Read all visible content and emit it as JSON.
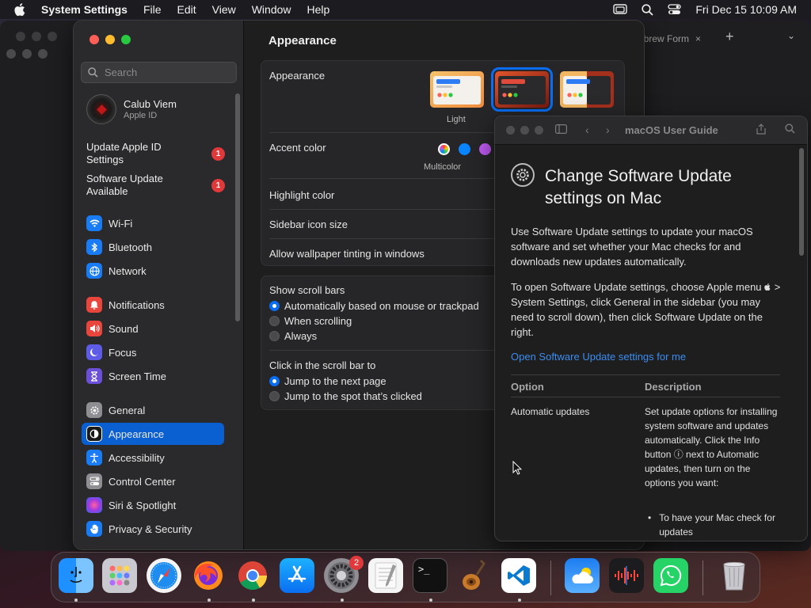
{
  "menubar": {
    "app_name": "System Settings",
    "items": [
      "File",
      "Edit",
      "View",
      "Window",
      "Help"
    ],
    "datetime": "Fri Dec 15  10:09 AM"
  },
  "browser": {
    "tab_title": "hbrew Form",
    "tab_close": "×",
    "new_tab": "+",
    "chevron": "⌄"
  },
  "sidebar": {
    "search_placeholder": "Search",
    "account_name": "Calub Viem",
    "account_sub": "Apple ID",
    "alerts": [
      {
        "label": "Update Apple ID Settings",
        "count": "1"
      },
      {
        "label": "Software Update Available",
        "count": "1"
      }
    ],
    "items": [
      {
        "label": "Wi-Fi",
        "icon": "wifi-icon",
        "color": "#1a7cf5"
      },
      {
        "label": "Bluetooth",
        "icon": "bluetooth-icon",
        "color": "#1a7cf5"
      },
      {
        "label": "Network",
        "icon": "globe-icon",
        "color": "#1a7cf5"
      },
      {
        "label": "Notifications",
        "icon": "bell-icon",
        "color": "#e8453c"
      },
      {
        "label": "Sound",
        "icon": "speaker-icon",
        "color": "#e8453c"
      },
      {
        "label": "Focus",
        "icon": "moon-icon",
        "color": "#5e5ce6"
      },
      {
        "label": "Screen Time",
        "icon": "hourglass-icon",
        "color": "#6b4fd8"
      },
      {
        "label": "General",
        "icon": "gear-icon",
        "color": "#8e8e93"
      },
      {
        "label": "Appearance",
        "icon": "appearance-icon",
        "color": "#1a1a1a"
      },
      {
        "label": "Accessibility",
        "icon": "accessibility-icon",
        "color": "#1a7cf5"
      },
      {
        "label": "Control Center",
        "icon": "control-center-icon",
        "color": "#8e8e93"
      },
      {
        "label": "Siri & Spotlight",
        "icon": "siri-icon",
        "color": "#c03ad1"
      },
      {
        "label": "Privacy & Security",
        "icon": "hand-icon",
        "color": "#1a7cf5"
      }
    ],
    "selected": "Appearance"
  },
  "main": {
    "title": "Appearance",
    "appearance_label": "Appearance",
    "appearance_options": [
      "Light"
    ],
    "accent_label": "Accent color",
    "accent_selected": "Multicolor",
    "accent_colors": [
      "#ff2d55",
      "#0a84ff",
      "#bf5af2"
    ],
    "highlight_label": "Highlight color",
    "sidebar_icon_label": "Sidebar icon size",
    "wallpaper_tint_label": "Allow wallpaper tinting in windows",
    "scroll_bars_label": "Show scroll bars",
    "scroll_bar_options": [
      "Automatically based on mouse or trackpad",
      "When scrolling",
      "Always"
    ],
    "scroll_bar_selected": 0,
    "click_label": "Click in the scroll bar to",
    "click_options": [
      "Jump to the next page",
      "Jump to the spot that’s clicked"
    ],
    "click_selected": 0
  },
  "help": {
    "window_title": "macOS User Guide",
    "heading": "Change Software Update settings on Mac",
    "para1": "Use Software Update settings to update your macOS software and set whether your Mac checks for and downloads new updates automatically.",
    "para2": " > System Settings, click General  in the sidebar (you may need to scroll down), then click Software Update on the right.",
    "para2_lead": "To open Software Update settings, choose Apple menu",
    "link": "Open Software Update settings for me",
    "col_option": "Option",
    "col_description": "Description",
    "row_option": "Automatic updates",
    "row_description": "Set update options for installing system software and updates automatically. Click the Info button ⓘ next to Automatic updates, then turn on the options you want:",
    "bullet": "To have your Mac check for updates"
  },
  "dock": {
    "apps": [
      {
        "name": "Finder",
        "icon": "finder-icon"
      },
      {
        "name": "Launchpad",
        "icon": "launchpad-icon"
      },
      {
        "name": "Safari",
        "icon": "safari-icon"
      },
      {
        "name": "Firefox",
        "icon": "firefox-icon"
      },
      {
        "name": "Chrome",
        "icon": "chrome-icon"
      },
      {
        "name": "App Store",
        "icon": "app-store-icon"
      },
      {
        "name": "System Settings",
        "icon": "system-settings-icon",
        "badge": "2"
      },
      {
        "name": "TextEdit",
        "icon": "textedit-icon"
      },
      {
        "name": "Terminal",
        "icon": "terminal-icon"
      },
      {
        "name": "GarageBand",
        "icon": "garageband-icon"
      },
      {
        "name": "Visual Studio Code",
        "icon": "vscode-icon"
      },
      {
        "name": "Weather",
        "icon": "weather-icon"
      },
      {
        "name": "Voice Memos",
        "icon": "voice-memos-icon"
      },
      {
        "name": "WhatsApp",
        "icon": "whatsapp-icon"
      },
      {
        "name": "Trash",
        "icon": "trash-icon"
      }
    ],
    "terminal_prompt": ">_"
  }
}
